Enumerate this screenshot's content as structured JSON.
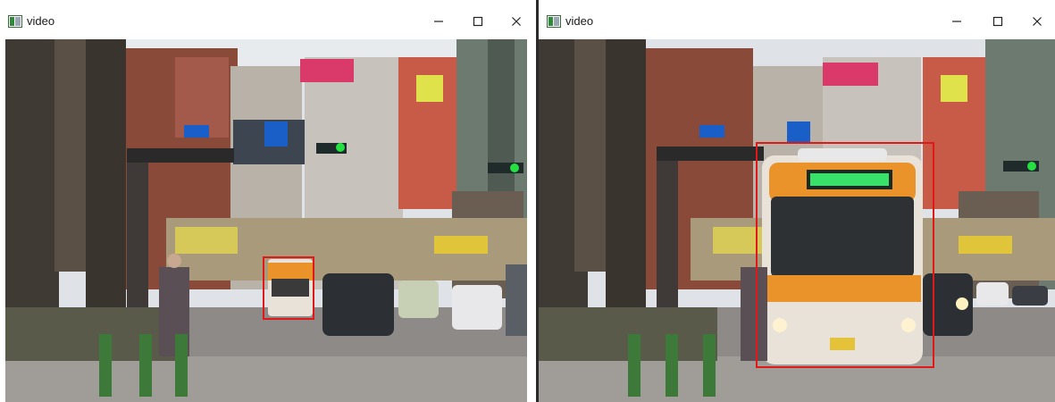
{
  "windows": [
    {
      "id": "left",
      "title": "video",
      "controls": {
        "minimize": "minimize-icon",
        "maximize": "maximize-icon",
        "close": "close-icon"
      },
      "detections": [
        {
          "object": "bus",
          "label": ""
        }
      ]
    },
    {
      "id": "right",
      "title": "video",
      "controls": {
        "minimize": "minimize-icon",
        "maximize": "maximize-icon",
        "close": "close-icon"
      },
      "detections": [
        {
          "object": "bus",
          "label": ""
        }
      ]
    }
  ],
  "colors": {
    "detection_box": "#e01818",
    "bus_body": "#e8e2d8",
    "bus_stripe": "#e9932a",
    "sky": "#dfe3e8",
    "road": "#8e8a88"
  }
}
